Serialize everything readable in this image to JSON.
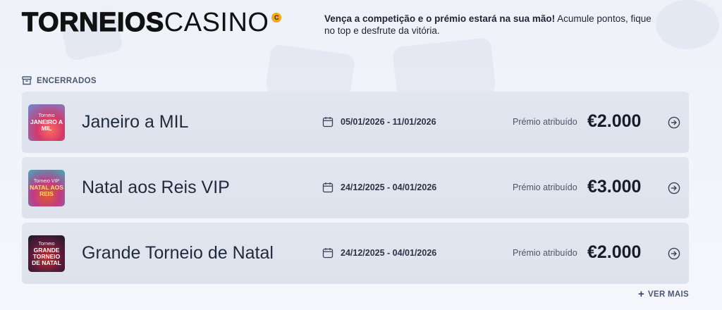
{
  "header": {
    "logo_bold": "TORNEIOS",
    "logo_thin": "CASINO",
    "logo_badge": "C",
    "tagline_bold": "Vença a competição e o prémio estará na sua mão!",
    "tagline_rest": " Acumule pontos, fique no top e desfrute da vitória."
  },
  "section": {
    "label": "ENCERRADOS",
    "icon": "archive-icon"
  },
  "tournaments": [
    {
      "thumb_top": "Torneio",
      "thumb_main": "JANEIRO A MIL",
      "name": "Janeiro a MIL",
      "dates": "05/01/2026 - 11/01/2026",
      "prize_label": "Prémio atribuído",
      "prize_value": "€2.000"
    },
    {
      "thumb_top": "Torneio VIP",
      "thumb_main": "NATAL AOS REIS",
      "name": "Natal aos Reis VIP",
      "dates": "24/12/2025 - 04/01/2026",
      "prize_label": "Prémio atribuído",
      "prize_value": "€3.000"
    },
    {
      "thumb_top": "Torneio",
      "thumb_main": "GRANDE TORNEIO DE NATAL",
      "name": "Grande Torneio de Natal",
      "dates": "24/12/2025 - 04/01/2026",
      "prize_label": "Prémio atribuído",
      "prize_value": "€2.000"
    }
  ],
  "footer": {
    "more_label": "VER MAIS",
    "more_icon": "plus-icon"
  },
  "colors": {
    "background": "#eef1f8",
    "card": "#dfe3ed",
    "badge": "#f2a91a",
    "text_dark": "#161c2b",
    "text_muted": "#4a5773"
  }
}
